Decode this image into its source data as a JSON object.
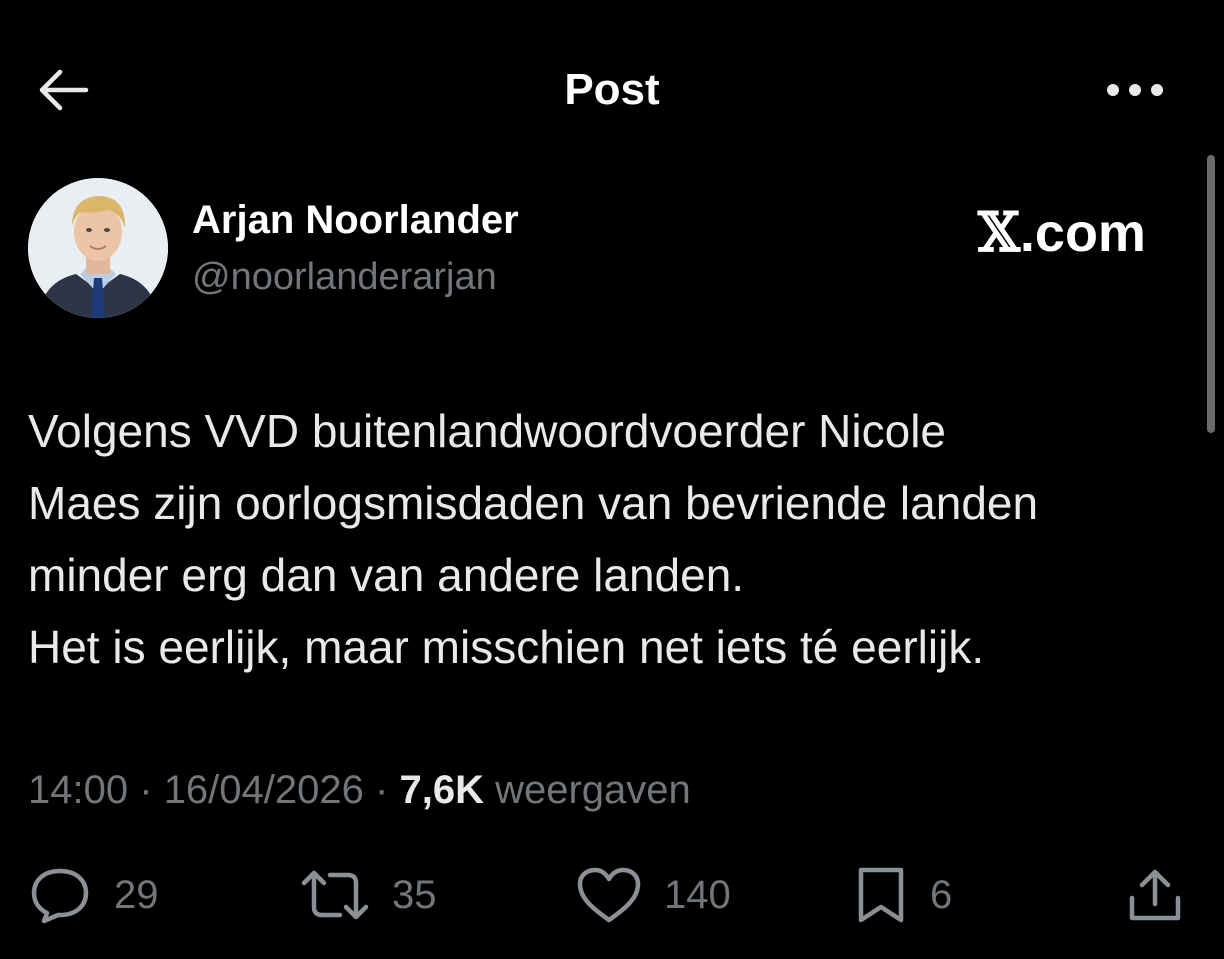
{
  "header": {
    "title": "Post"
  },
  "author": {
    "name": "Arjan Noorlander",
    "handle": "@noorlanderarjan"
  },
  "brand": {
    "mark": "𝕏",
    "suffix": ".com"
  },
  "post": {
    "lines": [
      "Volgens VVD buitenlandwoordvoerder Nicole",
      "Maes zijn oorlogsmisdaden van bevriende landen",
      "minder erg dan van andere landen.",
      "Het is eerlijk, maar misschien net iets té eerlijk."
    ]
  },
  "meta": {
    "time": "14:00",
    "separator": "·",
    "date": "16/04/2026",
    "views_count": "7,6K",
    "views_label": "weergaven"
  },
  "actions": {
    "replies": "29",
    "reposts": "35",
    "likes": "140",
    "bookmarks": "6"
  },
  "icons": {
    "back": "arrow-left-icon",
    "more": "more-horizontal-icon",
    "reply": "reply-icon",
    "repost": "repost-icon",
    "like": "heart-icon",
    "bookmark": "bookmark-icon",
    "share": "share-icon"
  },
  "colors": {
    "background": "#000000",
    "text_primary": "#e7e9ea",
    "text_secondary": "#71767b",
    "white": "#ffffff"
  }
}
